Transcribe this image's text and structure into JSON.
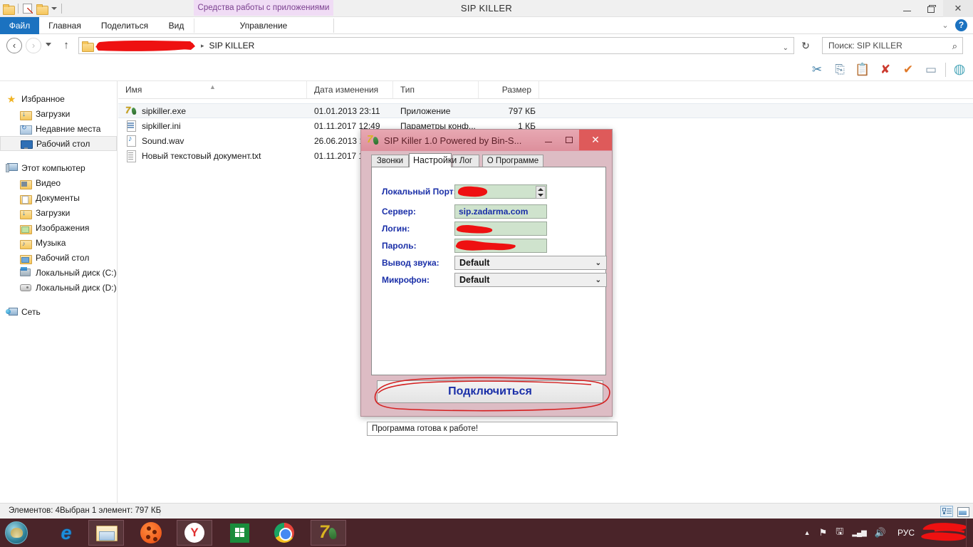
{
  "window": {
    "title": "SIP KILLER",
    "contextual_ribbon_label": "Средства работы с приложениями",
    "minimize": "—",
    "restore": "❐",
    "close": "✕"
  },
  "ribbon": {
    "tabs": [
      {
        "label": "Файл",
        "active": false,
        "highlighted": true
      },
      {
        "label": "Главная",
        "active": false
      },
      {
        "label": "Поделиться",
        "active": false
      },
      {
        "label": "Вид",
        "active": false
      },
      {
        "label": "Управление",
        "active": false
      }
    ],
    "help_icon": "?",
    "collapse_icon": "chevron-down-icon",
    "collapse_glyph": "⌄"
  },
  "address": {
    "back_glyph": "‹",
    "forward_glyph": "›",
    "recent_glyph": "▾",
    "up_glyph": "↑",
    "redacted_segment": "[REDACTED]",
    "current_folder": "SIP KILLER",
    "separator": "▸",
    "dropdown_glyph": "⌄",
    "refresh_glyph": "↻"
  },
  "search": {
    "placeholder": "Поиск: SIP KILLER",
    "icon_glyph": "⌕"
  },
  "commands": [
    {
      "name": "cut-icon",
      "glyph": "✂",
      "color": "#3f7fa8"
    },
    {
      "name": "copy-icon",
      "glyph": "⎘",
      "color": "#6b8ea8"
    },
    {
      "name": "paste-icon",
      "glyph": "📋",
      "color": "#c8a25a"
    },
    {
      "name": "delete-icon",
      "glyph": "✘",
      "color": "#cc3b2f"
    },
    {
      "name": "confirm-icon",
      "glyph": "✔",
      "color": "#e07a2a"
    },
    {
      "name": "rename-icon",
      "glyph": "▭",
      "color": "#7b93a6"
    },
    {
      "name": "shell-icon",
      "glyph": "◍",
      "color": "#4fa9bb"
    }
  ],
  "sidebar": {
    "groups": [
      {
        "header": {
          "label": "Избранное",
          "icon": "star-icon"
        },
        "items": [
          {
            "label": "Загрузки",
            "icon": "folder-downloads-icon",
            "selected": false
          },
          {
            "label": "Недавние места",
            "icon": "recent-places-icon",
            "selected": false
          },
          {
            "label": "Рабочий стол",
            "icon": "desktop-monitor-icon",
            "selected": true
          }
        ]
      },
      {
        "header": {
          "label": "Этот компьютер",
          "icon": "this-pc-icon"
        },
        "items": [
          {
            "label": "Видео",
            "icon": "folder-videos-icon",
            "selected": false
          },
          {
            "label": "Документы",
            "icon": "folder-documents-icon",
            "selected": false
          },
          {
            "label": "Загрузки",
            "icon": "folder-downloads-icon",
            "selected": false
          },
          {
            "label": "Изображения",
            "icon": "folder-pictures-icon",
            "selected": false
          },
          {
            "label": "Музыка",
            "icon": "folder-music-icon",
            "selected": false
          },
          {
            "label": "Рабочий стол",
            "icon": "folder-desktop-icon",
            "selected": false
          },
          {
            "label": "Локальный диск (C:)",
            "icon": "drive-c-icon",
            "selected": false
          },
          {
            "label": "Локальный диск (D:)",
            "icon": "drive-d-icon",
            "selected": false
          }
        ]
      },
      {
        "header": {
          "label": "Сеть",
          "icon": "network-icon"
        },
        "items": []
      }
    ]
  },
  "filelist": {
    "columns": [
      {
        "label": "Имя",
        "sorted": true,
        "sort_glyph": "▲"
      },
      {
        "label": "Дата изменения"
      },
      {
        "label": "Тип"
      },
      {
        "label": "Размер"
      }
    ],
    "rows": [
      {
        "name": "sipkiller.exe",
        "date": "01.01.2013 23:11",
        "type": "Приложение",
        "size": "797 КБ",
        "icon": "sipkiller-exe-icon",
        "selected": true
      },
      {
        "name": "sipkiller.ini",
        "date": "01.11.2017 12:49",
        "type": "Параметры конф...",
        "size": "1 КБ",
        "icon": "ini-file-icon",
        "selected": false
      },
      {
        "name": "Sound.wav",
        "date": "26.06.2013 1",
        "type": "",
        "size": "",
        "icon": "wav-file-icon",
        "selected": false
      },
      {
        "name": "Новый текстовый документ.txt",
        "date": "01.11.2017 1",
        "type": "",
        "size": "",
        "icon": "txt-file-icon",
        "selected": false
      }
    ]
  },
  "statusbar": {
    "item_count": "Элементов: 4",
    "selection": "Выбран 1 элемент: 797 КБ",
    "view_details_name": "details-view-icon",
    "view_icons_name": "large-icons-view-icon"
  },
  "sip_dialog": {
    "title": "SIP Killer 1.0 Powered by Bin-S...",
    "icon": "sipkiller-app-icon",
    "minimize": "—",
    "maximize": "❐",
    "close": "✕",
    "tabs": [
      {
        "label": "Звонки",
        "active": false
      },
      {
        "label": "Настройки",
        "active": true
      },
      {
        "label": "Лог",
        "active": false
      },
      {
        "label": "О Программе",
        "active": false
      }
    ],
    "fields": [
      {
        "label": "Локальный Порт:",
        "value": "",
        "redacted": true,
        "control": "spinner"
      },
      {
        "label": "Сервер:",
        "value": "sip.zadarma.com",
        "redacted": false,
        "control": "text"
      },
      {
        "label": "Логин:",
        "value": "",
        "redacted": true,
        "control": "text"
      },
      {
        "label": "Пароль:",
        "value": "",
        "redacted": true,
        "control": "text"
      },
      {
        "label": "Вывод звука:",
        "value": "Default",
        "redacted": false,
        "control": "select"
      },
      {
        "label": "Микрофон:",
        "value": "Default",
        "redacted": false,
        "control": "select"
      }
    ],
    "connect_button": "Подключиться",
    "status_text": "Программа готова к работе!",
    "annotation_color": "#d42020"
  },
  "taskbar": {
    "start_name": "start-button",
    "items": [
      {
        "name": "taskbar-internet-explorer",
        "icon": "internet-explorer-icon",
        "boxed": false
      },
      {
        "name": "taskbar-file-explorer",
        "icon": "file-explorer-icon",
        "boxed": true
      },
      {
        "name": "taskbar-media-player",
        "icon": "media-player-icon",
        "boxed": false
      },
      {
        "name": "taskbar-yandex-browser",
        "icon": "yandex-browser-icon",
        "boxed": true
      },
      {
        "name": "taskbar-windows-store",
        "icon": "windows-store-icon",
        "boxed": false
      },
      {
        "name": "taskbar-google-chrome",
        "icon": "google-chrome-icon",
        "boxed": false
      },
      {
        "name": "taskbar-sip-killer",
        "icon": "sipkiller-app-icon",
        "boxed": true
      }
    ],
    "tray": [
      {
        "name": "tray-expand-icon",
        "glyph": "▲"
      },
      {
        "name": "tray-action-center-icon",
        "glyph": "⚑"
      },
      {
        "name": "tray-device-icon",
        "glyph": "🖫"
      },
      {
        "name": "tray-network-icon",
        "glyph": "▂▄▆"
      },
      {
        "name": "tray-volume-icon",
        "glyph": "🔊"
      }
    ],
    "language": "РУС",
    "clock_redacted": true
  },
  "colors": {
    "accent_blue": "#1b72c0",
    "ribbon_contextual": "#f0dcf5",
    "dialog_chrome": "#ddbcc4",
    "dialog_titlebar": "#e09aa6",
    "field_green": "#cfe3cd",
    "label_blue": "#1a2fa8",
    "redaction_red": "#ee1111",
    "taskbar": "#4a2429"
  }
}
